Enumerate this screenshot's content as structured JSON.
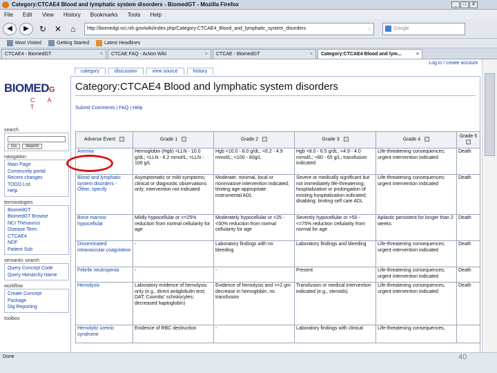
{
  "window": {
    "title": "Category:CTCAE4 Blood and lymphatic system disorders - BiomedGT - Mozilla Firefox",
    "buttons": [
      "_",
      "□",
      "X"
    ]
  },
  "menu": [
    "File",
    "Edit",
    "View",
    "History",
    "Bookmarks",
    "Tools",
    "Help"
  ],
  "nav": {
    "url": "http://biomedgt.nci.nih.gov/wiki/index.php/Category:CTCAE4_Blood_and_lymphatic_system_disorders",
    "search_placeholder": "Google"
  },
  "bookmarks": [
    "Most Visited",
    "Getting Started",
    "Latest Headlines"
  ],
  "tabs": [
    {
      "label": "CTCAE4 - BiomedGT",
      "active": false
    },
    {
      "label": "CTCAE FAQ - Action Wiki",
      "active": false
    },
    {
      "label": "CTCAE - BiomedGT",
      "active": false
    },
    {
      "label": "Category:CTCAE4 Blood and lym...",
      "active": true
    }
  ],
  "page": {
    "userlinks": "Log in / create account",
    "page_tabs": [
      "category",
      "discussion",
      "view source",
      "history"
    ],
    "logo_text": "BIOMED",
    "logo_g": "G",
    "logo_letters": "C A T",
    "heading": "Category:CTCAE4 Blood and lymphatic system disorders",
    "sublinks": "Submit Comments | FAQ | Help"
  },
  "sidebar": {
    "search_label": "search",
    "go": "Go",
    "search": "Search",
    "navigation_label": "navigation",
    "navigation": [
      "Main Page",
      "Community portal",
      "Recent changes",
      "TODO List",
      "Help"
    ],
    "terminologies_label": "terminologies",
    "terminologies": [
      "BiomedGT",
      "BiomedGT Browse",
      "NCI Thesaurus",
      "Disease Term",
      "CTCAE4",
      "NDF",
      "Patient Sub"
    ],
    "queries_label": "semantic search",
    "queries": [
      "Query Concept Code",
      "Query Hierarchy Name"
    ],
    "workflow_label": "workflow",
    "workflow": [
      "Create Concept",
      "Package",
      "Dig Reporting"
    ],
    "toolbox_label": "toolbox"
  },
  "table": {
    "headers": [
      "Adverse Event",
      "Grade 1",
      "Grade 2",
      "Grade 3",
      "Grade 4",
      "Grade 5"
    ],
    "rows": [
      [
        "Anemia",
        "Hemoglobin (Hgb) <LLN - 10.0 g/dL; <LLN - 6.2 mmol/L; <LLN - 100 g/L",
        "Hgb <10.0 - 8.0 g/dL; <6.2 - 4.9 mmol/L; <100 - 80g/L",
        "Hgb <8.0 - 6.5 g/dL; <4.9 - 4.0 mmol/L; <80 - 65 g/L; transfusion indicated",
        "Life-threatening consequences; urgent intervention indicated",
        "Death"
      ],
      [
        "Blood and lymphatic system disorders - Other, specify",
        "Asymptomatic or mild symptoms; clinical or diagnostic observations only; intervention not indicated",
        "Moderate; minimal, local or noninvasive intervention indicated; limiting age-appropriate instrumental ADL",
        "Severe or medically significant but not immediately life-threatening; hospitalization or prolongation of existing hospitalization indicated; disabling; limiting self care ADL",
        "Life-threatening consequences; urgent intervention indicated",
        "Death"
      ],
      [
        "Bone marrow hypocellular",
        "Mildly hypocellular or <=25% reduction from normal cellularity for age",
        "Moderately hypocellular or >25 - <50% reduction from normal cellularity for age",
        "Severely hypocellular or >50 - <=75% reduction cellularity from normal for age",
        "Aplastic persistent for longer than 2 weeks",
        "Death"
      ],
      [
        "Disseminated intravascular coagulation",
        "-",
        "Laboratory findings with no bleeding",
        "Laboratory findings and bleeding",
        "Life-threatening consequences; urgent intervention indicated",
        "Death"
      ],
      [
        "Febrile neutropenia",
        "-",
        "-",
        "Present",
        "Life-threatening consequences; urgent intervention indicated",
        "Death"
      ],
      [
        "Hemolysis",
        "Laboratory evidence of hemolysis only (e.g., direct antiglobulin test; DAT; Coombs' schistocytes; decreased haptoglobin)",
        "Evidence of hemolysis and >=2 gm decrease in hemoglobin, no transfusion",
        "Transfusion or medical intervention indicated (e.g., steroids)",
        "Life-threatening consequences; urgent intervention indicated",
        "Death"
      ],
      [
        "Hemolytic uremic syndrome",
        "Evidence of RBC destruction",
        "-",
        "Laboratory findings with clinical",
        "Life-threatening consequences,",
        ""
      ]
    ]
  },
  "status": {
    "text": "Done",
    "page_number": "40"
  }
}
